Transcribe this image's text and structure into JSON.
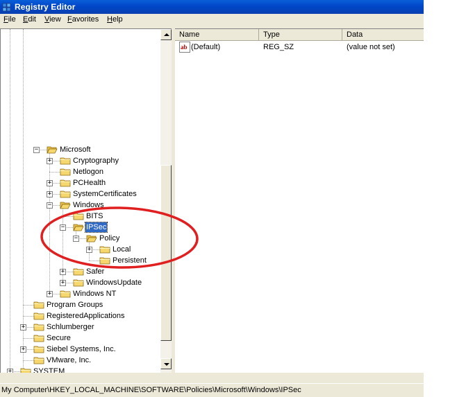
{
  "window": {
    "title": "Registry Editor"
  },
  "menu": [
    {
      "key": "file",
      "accel": "F",
      "rest": "ile"
    },
    {
      "key": "edit",
      "accel": "E",
      "rest": "dit"
    },
    {
      "key": "view",
      "accel": "V",
      "rest": "iew"
    },
    {
      "key": "favorites",
      "accel": "F",
      "rest": "avorites"
    },
    {
      "key": "help",
      "accel": "H",
      "rest": "elp"
    }
  ],
  "tree": {
    "nodes": [
      {
        "label": "Microsoft",
        "expander": "−",
        "indent": 3,
        "row": 0
      },
      {
        "label": "Cryptography",
        "expander": "+",
        "indent": 4,
        "row": 1
      },
      {
        "label": "Netlogon",
        "expander": "",
        "indent": 4,
        "row": 2
      },
      {
        "label": "PCHealth",
        "expander": "+",
        "indent": 4,
        "row": 3
      },
      {
        "label": "SystemCertificates",
        "expander": "+",
        "indent": 4,
        "row": 4
      },
      {
        "label": "Windows",
        "expander": "−",
        "indent": 4,
        "row": 5
      },
      {
        "label": "BITS",
        "expander": "",
        "indent": 5,
        "row": 6
      },
      {
        "label": "IPSec",
        "expander": "−",
        "indent": 5,
        "row": 7,
        "selected": true
      },
      {
        "label": "Policy",
        "expander": "−",
        "indent": 6,
        "row": 8
      },
      {
        "label": "Local",
        "expander": "+",
        "indent": 7,
        "row": 9
      },
      {
        "label": "Persistent",
        "expander": "",
        "indent": 7,
        "row": 10
      },
      {
        "label": "Safer",
        "expander": "+",
        "indent": 5,
        "row": 11
      },
      {
        "label": "WindowsUpdate",
        "expander": "+",
        "indent": 5,
        "row": 12
      },
      {
        "label": "Windows NT",
        "expander": "+",
        "indent": 4,
        "row": 13
      },
      {
        "label": "Program Groups",
        "expander": "",
        "indent": 2,
        "row": 14
      },
      {
        "label": "RegisteredApplications",
        "expander": "",
        "indent": 2,
        "row": 15
      },
      {
        "label": "Schlumberger",
        "expander": "+",
        "indent": 2,
        "row": 16
      },
      {
        "label": "Secure",
        "expander": "",
        "indent": 2,
        "row": 17
      },
      {
        "label": "Siebel Systems, Inc.",
        "expander": "+",
        "indent": 2,
        "row": 18
      },
      {
        "label": "VMware, Inc.",
        "expander": "",
        "indent": 2,
        "row": 19
      },
      {
        "label": "SYSTEM",
        "expander": "+",
        "indent": 1,
        "row": 20
      }
    ]
  },
  "list": {
    "columns": [
      {
        "key": "name",
        "label": "Name"
      },
      {
        "key": "type",
        "label": "Type"
      },
      {
        "key": "data",
        "label": "Data"
      }
    ],
    "rows": [
      {
        "name": "(Default)",
        "type": "REG_SZ",
        "data": "(value not set)",
        "icon": "string-value-icon",
        "icon_text": "ab"
      }
    ]
  },
  "status": {
    "path": "My Computer\\HKEY_LOCAL_MACHINE\\SOFTWARE\\Policies\\Microsoft\\Windows\\IPSec"
  },
  "colors": {
    "selection": "#316ac5",
    "annotation": "#e02020",
    "folder": "#f5d76e",
    "title_bar": "#0a5fd8"
  }
}
